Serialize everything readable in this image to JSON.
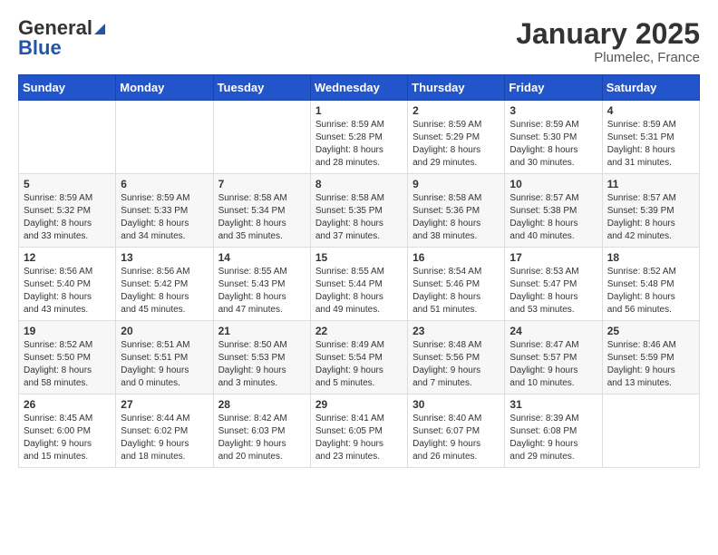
{
  "header": {
    "logo_general": "General",
    "logo_blue": "Blue",
    "month": "January 2025",
    "location": "Plumelec, France"
  },
  "weekdays": [
    "Sunday",
    "Monday",
    "Tuesday",
    "Wednesday",
    "Thursday",
    "Friday",
    "Saturday"
  ],
  "weeks": [
    [
      {
        "day": "",
        "detail": ""
      },
      {
        "day": "",
        "detail": ""
      },
      {
        "day": "",
        "detail": ""
      },
      {
        "day": "1",
        "detail": "Sunrise: 8:59 AM\nSunset: 5:28 PM\nDaylight: 8 hours\nand 28 minutes."
      },
      {
        "day": "2",
        "detail": "Sunrise: 8:59 AM\nSunset: 5:29 PM\nDaylight: 8 hours\nand 29 minutes."
      },
      {
        "day": "3",
        "detail": "Sunrise: 8:59 AM\nSunset: 5:30 PM\nDaylight: 8 hours\nand 30 minutes."
      },
      {
        "day": "4",
        "detail": "Sunrise: 8:59 AM\nSunset: 5:31 PM\nDaylight: 8 hours\nand 31 minutes."
      }
    ],
    [
      {
        "day": "5",
        "detail": "Sunrise: 8:59 AM\nSunset: 5:32 PM\nDaylight: 8 hours\nand 33 minutes."
      },
      {
        "day": "6",
        "detail": "Sunrise: 8:59 AM\nSunset: 5:33 PM\nDaylight: 8 hours\nand 34 minutes."
      },
      {
        "day": "7",
        "detail": "Sunrise: 8:58 AM\nSunset: 5:34 PM\nDaylight: 8 hours\nand 35 minutes."
      },
      {
        "day": "8",
        "detail": "Sunrise: 8:58 AM\nSunset: 5:35 PM\nDaylight: 8 hours\nand 37 minutes."
      },
      {
        "day": "9",
        "detail": "Sunrise: 8:58 AM\nSunset: 5:36 PM\nDaylight: 8 hours\nand 38 minutes."
      },
      {
        "day": "10",
        "detail": "Sunrise: 8:57 AM\nSunset: 5:38 PM\nDaylight: 8 hours\nand 40 minutes."
      },
      {
        "day": "11",
        "detail": "Sunrise: 8:57 AM\nSunset: 5:39 PM\nDaylight: 8 hours\nand 42 minutes."
      }
    ],
    [
      {
        "day": "12",
        "detail": "Sunrise: 8:56 AM\nSunset: 5:40 PM\nDaylight: 8 hours\nand 43 minutes."
      },
      {
        "day": "13",
        "detail": "Sunrise: 8:56 AM\nSunset: 5:42 PM\nDaylight: 8 hours\nand 45 minutes."
      },
      {
        "day": "14",
        "detail": "Sunrise: 8:55 AM\nSunset: 5:43 PM\nDaylight: 8 hours\nand 47 minutes."
      },
      {
        "day": "15",
        "detail": "Sunrise: 8:55 AM\nSunset: 5:44 PM\nDaylight: 8 hours\nand 49 minutes."
      },
      {
        "day": "16",
        "detail": "Sunrise: 8:54 AM\nSunset: 5:46 PM\nDaylight: 8 hours\nand 51 minutes."
      },
      {
        "day": "17",
        "detail": "Sunrise: 8:53 AM\nSunset: 5:47 PM\nDaylight: 8 hours\nand 53 minutes."
      },
      {
        "day": "18",
        "detail": "Sunrise: 8:52 AM\nSunset: 5:48 PM\nDaylight: 8 hours\nand 56 minutes."
      }
    ],
    [
      {
        "day": "19",
        "detail": "Sunrise: 8:52 AM\nSunset: 5:50 PM\nDaylight: 8 hours\nand 58 minutes."
      },
      {
        "day": "20",
        "detail": "Sunrise: 8:51 AM\nSunset: 5:51 PM\nDaylight: 9 hours\nand 0 minutes."
      },
      {
        "day": "21",
        "detail": "Sunrise: 8:50 AM\nSunset: 5:53 PM\nDaylight: 9 hours\nand 3 minutes."
      },
      {
        "day": "22",
        "detail": "Sunrise: 8:49 AM\nSunset: 5:54 PM\nDaylight: 9 hours\nand 5 minutes."
      },
      {
        "day": "23",
        "detail": "Sunrise: 8:48 AM\nSunset: 5:56 PM\nDaylight: 9 hours\nand 7 minutes."
      },
      {
        "day": "24",
        "detail": "Sunrise: 8:47 AM\nSunset: 5:57 PM\nDaylight: 9 hours\nand 10 minutes."
      },
      {
        "day": "25",
        "detail": "Sunrise: 8:46 AM\nSunset: 5:59 PM\nDaylight: 9 hours\nand 13 minutes."
      }
    ],
    [
      {
        "day": "26",
        "detail": "Sunrise: 8:45 AM\nSunset: 6:00 PM\nDaylight: 9 hours\nand 15 minutes."
      },
      {
        "day": "27",
        "detail": "Sunrise: 8:44 AM\nSunset: 6:02 PM\nDaylight: 9 hours\nand 18 minutes."
      },
      {
        "day": "28",
        "detail": "Sunrise: 8:42 AM\nSunset: 6:03 PM\nDaylight: 9 hours\nand 20 minutes."
      },
      {
        "day": "29",
        "detail": "Sunrise: 8:41 AM\nSunset: 6:05 PM\nDaylight: 9 hours\nand 23 minutes."
      },
      {
        "day": "30",
        "detail": "Sunrise: 8:40 AM\nSunset: 6:07 PM\nDaylight: 9 hours\nand 26 minutes."
      },
      {
        "day": "31",
        "detail": "Sunrise: 8:39 AM\nSunset: 6:08 PM\nDaylight: 9 hours\nand 29 minutes."
      },
      {
        "day": "",
        "detail": ""
      }
    ]
  ]
}
